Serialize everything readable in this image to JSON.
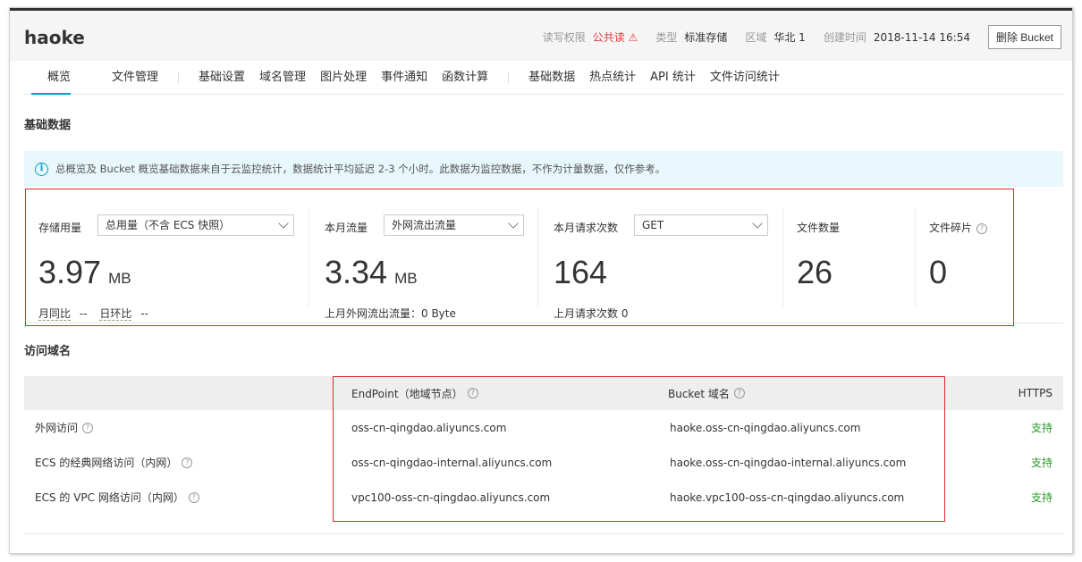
{
  "header": {
    "bucket_name": "haoke",
    "read_write_label": "读写权限",
    "read_write_value": "公共读",
    "type_label": "类型",
    "type_value": "标准存储",
    "region_label": "区域",
    "region_value": "华北 1",
    "created_label": "创建时间",
    "created_value": "2018-11-14 16:54",
    "delete_button": "删除 Bucket"
  },
  "tabs": [
    {
      "label": "概览"
    },
    {
      "label": "文件管理"
    },
    {
      "label": "基础设置"
    },
    {
      "label": "域名管理"
    },
    {
      "label": "图片处理"
    },
    {
      "label": "事件通知"
    },
    {
      "label": "函数计算"
    },
    {
      "label": "基础数据"
    },
    {
      "label": "热点统计"
    },
    {
      "label": "API 统计"
    },
    {
      "label": "文件访问统计"
    }
  ],
  "basic": {
    "title": "基础数据",
    "notice": "总概览及 Bucket 概览基础数据来自于云监控统计，数据统计平均延迟 2-3 个小时。此数据为监控数据，不作为计量数据，仅作参考。"
  },
  "stats": {
    "storage": {
      "label": "存储用量",
      "select": "总用量（不含 ECS 快照）",
      "value": "3.97",
      "unit": "MB",
      "mom_label": "月同比",
      "mom_value": "--",
      "dod_label": "日环比",
      "dod_value": "--"
    },
    "traffic": {
      "label": "本月流量",
      "select": "外网流出流量",
      "value": "3.34",
      "unit": "MB",
      "sub": "上月外网流出流量：0 Byte"
    },
    "requests": {
      "label": "本月请求次数",
      "select": "GET",
      "value": "164",
      "sub": "上月请求次数  0"
    },
    "files": {
      "label": "文件数量",
      "value": "26"
    },
    "fragments": {
      "label": "文件碎片",
      "value": "0"
    }
  },
  "domains": {
    "title": "访问域名",
    "headers": {
      "endpoint": "EndPoint（地域节点）",
      "bucket_domain": "Bucket 域名",
      "https": "HTTPS"
    },
    "rows": [
      {
        "name": "外网访问",
        "endpoint": "oss-cn-qingdao.aliyuncs.com",
        "bucket": "haoke.oss-cn-qingdao.aliyuncs.com",
        "https": "支持"
      },
      {
        "name": "ECS 的经典网络访问（内网）",
        "endpoint": "oss-cn-qingdao-internal.aliyuncs.com",
        "bucket": "haoke.oss-cn-qingdao-internal.aliyuncs.com",
        "https": "支持"
      },
      {
        "name": "ECS 的 VPC 网络访问（内网）",
        "endpoint": "vpc100-oss-cn-qingdao.aliyuncs.com",
        "bucket": "haoke.vpc100-oss-cn-qingdao.aliyuncs.com",
        "https": "支持"
      }
    ]
  },
  "colors": {
    "accent": "#00a2ca",
    "warn": "#e4393c",
    "ok": "#2b9a2b",
    "highlight": "#e0262d"
  }
}
